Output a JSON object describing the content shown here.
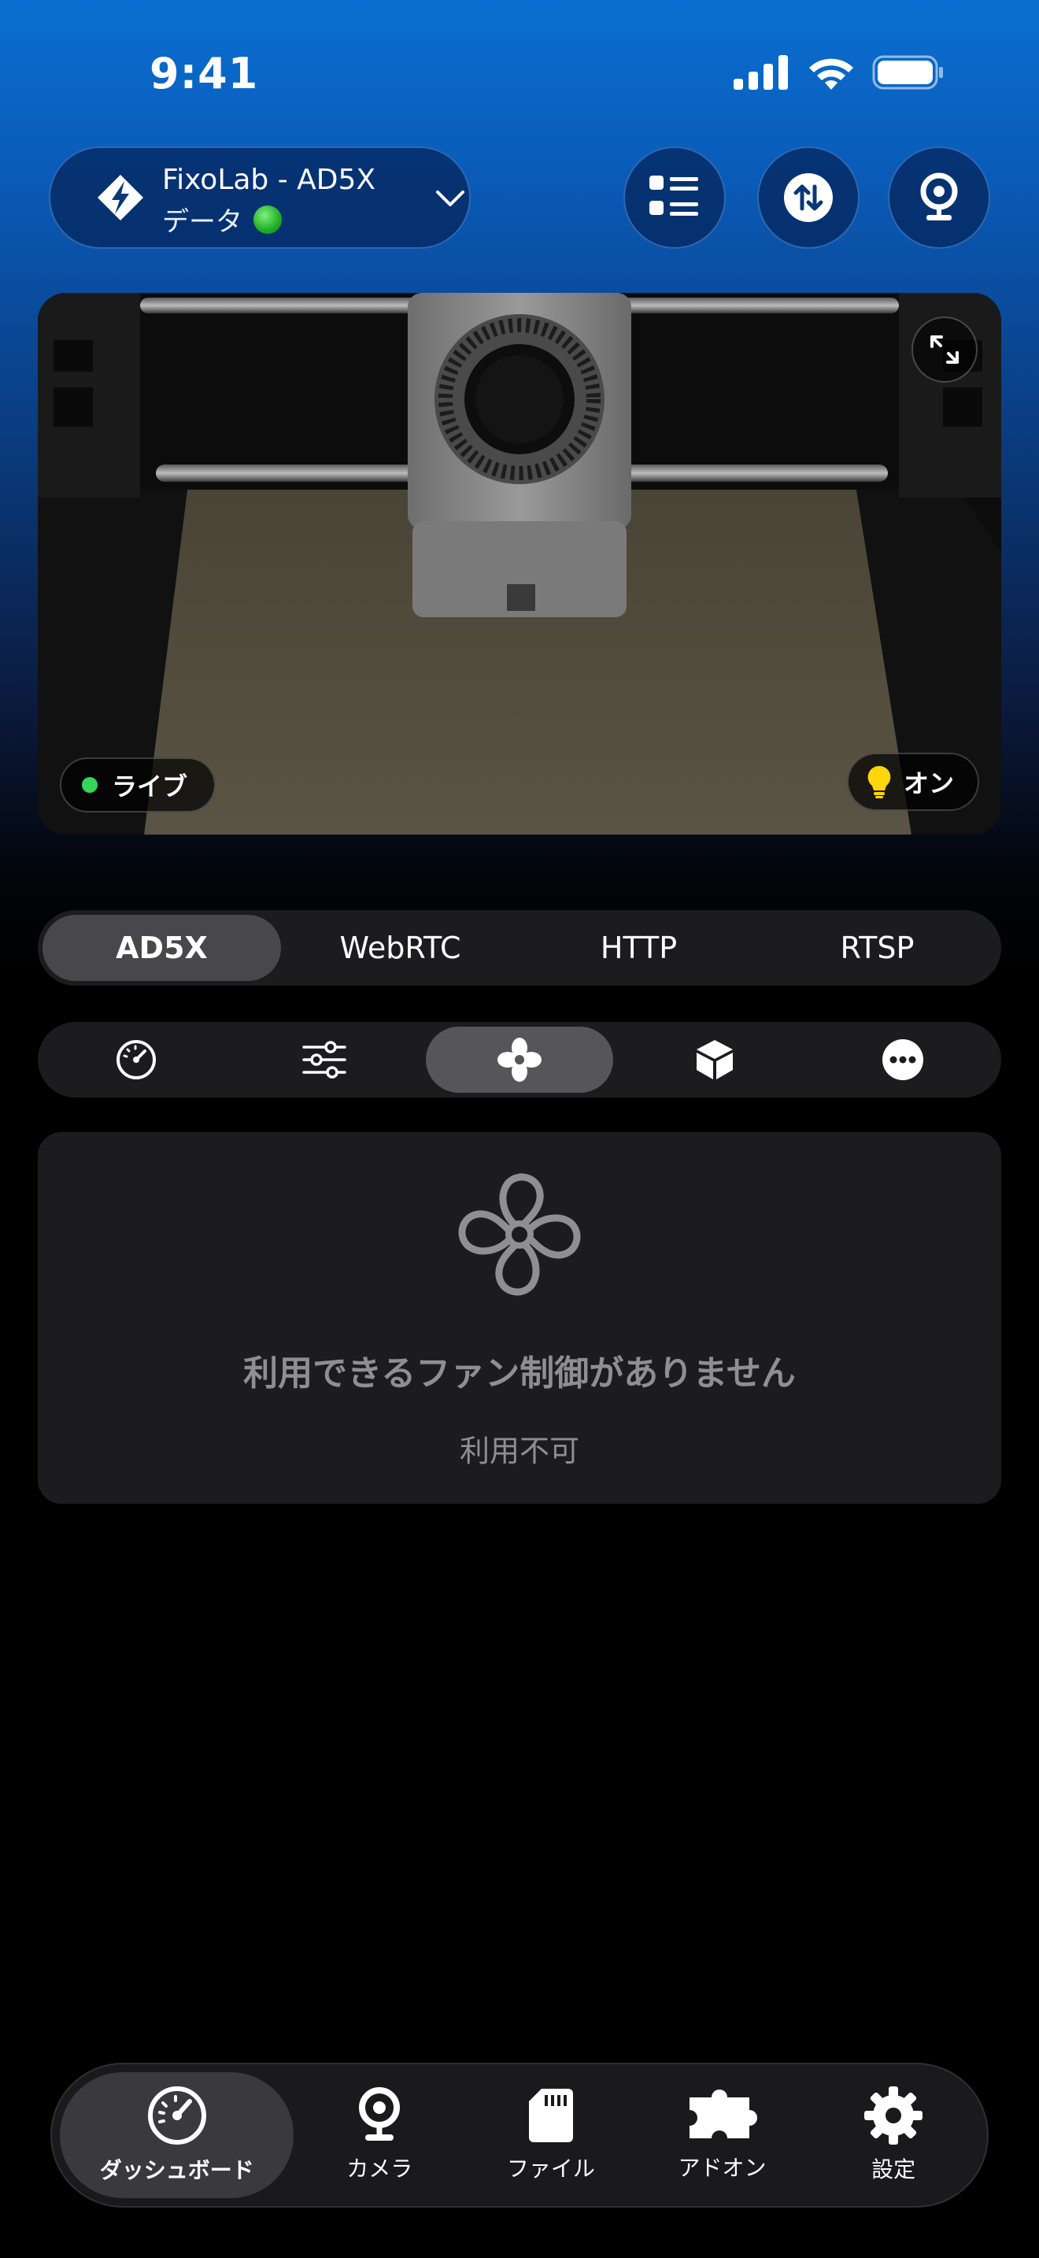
{
  "status_bar": {
    "time": "9:41"
  },
  "header": {
    "device_name": "FixoLab - AD5X",
    "device_sub_label": "データ",
    "connection_status_color": "#2ecc40"
  },
  "camera": {
    "live_label": "ライブ",
    "light_label": "オン",
    "live_dot_color": "#33d55a"
  },
  "stream_tabs": [
    {
      "label": "AD5X",
      "active": true
    },
    {
      "label": "WebRTC",
      "active": false
    },
    {
      "label": "HTTP",
      "active": false
    },
    {
      "label": "RTSP",
      "active": false
    }
  ],
  "tool_tabs": [
    {
      "icon": "gauge-icon",
      "active": false
    },
    {
      "icon": "sliders-icon",
      "active": false
    },
    {
      "icon": "fan-icon",
      "active": true
    },
    {
      "icon": "cube-icon",
      "active": false
    },
    {
      "icon": "more-icon",
      "active": false
    }
  ],
  "empty_state": {
    "title": "利用できるファン制御がありません",
    "subtitle": "利用不可"
  },
  "tab_bar": [
    {
      "label": "ダッシュボード",
      "icon": "dashboard-icon",
      "active": true
    },
    {
      "label": "カメラ",
      "icon": "webcam-icon",
      "active": false
    },
    {
      "label": "ファイル",
      "icon": "sd-card-icon",
      "active": false
    },
    {
      "label": "アドオン",
      "icon": "puzzle-icon",
      "active": false
    },
    {
      "label": "設定",
      "icon": "gear-icon",
      "active": false
    }
  ]
}
